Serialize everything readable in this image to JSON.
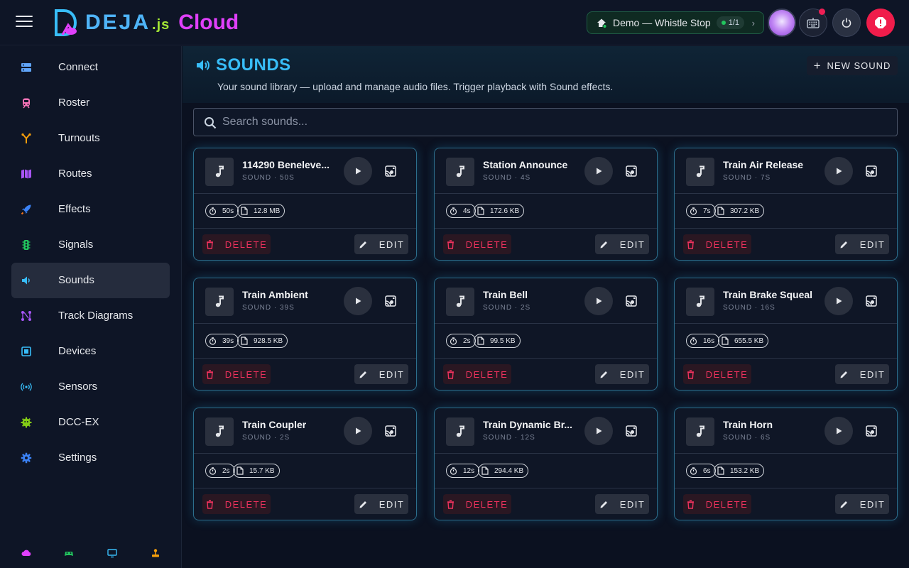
{
  "app": {
    "logo_deja": "DEJA",
    "logo_js": ".js",
    "logo_cloud": "Cloud"
  },
  "header": {
    "layout_label": "Demo — Whistle Stop",
    "layout_badge": "1/1",
    "colors": {
      "accent": "#38bdf8",
      "estop": "#f01d4b",
      "brand": "#e040fb"
    }
  },
  "sidebar": {
    "items": [
      {
        "label": "Connect",
        "icon": "server-icon",
        "color": "#60a5fa"
      },
      {
        "label": "Roster",
        "icon": "train-icon",
        "color": "#f472b6"
      },
      {
        "label": "Turnouts",
        "icon": "fork-icon",
        "color": "#f59e0b"
      },
      {
        "label": "Routes",
        "icon": "map-icon",
        "color": "#a855f7"
      },
      {
        "label": "Effects",
        "icon": "rocket-icon",
        "color": "#3b82f6"
      },
      {
        "label": "Signals",
        "icon": "traffic-light-icon",
        "color": "#22c55e"
      },
      {
        "label": "Sounds",
        "icon": "speaker-icon",
        "color": "#38bdf8"
      },
      {
        "label": "Track Diagrams",
        "icon": "graph-icon",
        "color": "#a855f7"
      },
      {
        "label": "Devices",
        "icon": "chip-icon",
        "color": "#38bdf8"
      },
      {
        "label": "Sensors",
        "icon": "broadcast-icon",
        "color": "#38bdf8"
      },
      {
        "label": "DCC-EX",
        "icon": "cog-chip-icon",
        "color": "#84cc16"
      },
      {
        "label": "Settings",
        "icon": "gear-icon",
        "color": "#3b82f6"
      }
    ],
    "active": "Sounds"
  },
  "page": {
    "title": "SOUNDS",
    "subtitle": "Your sound library — upload and manage audio files. Trigger playback with Sound effects.",
    "new_button": "NEW SOUND",
    "search_placeholder": "Search sounds..."
  },
  "sounds": [
    {
      "name": "114290 Beneleve...",
      "meta": "SOUND · 50S",
      "duration": "50s",
      "size": "12.8 MB"
    },
    {
      "name": "Station Announce",
      "meta": "SOUND · 4S",
      "duration": "4s",
      "size": "172.6 KB"
    },
    {
      "name": "Train Air Release",
      "meta": "SOUND · 7S",
      "duration": "7s",
      "size": "307.2 KB"
    },
    {
      "name": "Train Ambient",
      "meta": "SOUND · 39S",
      "duration": "39s",
      "size": "928.5 KB"
    },
    {
      "name": "Train Bell",
      "meta": "SOUND · 2S",
      "duration": "2s",
      "size": "99.5 KB"
    },
    {
      "name": "Train Brake Squeal",
      "meta": "SOUND · 16S",
      "duration": "16s",
      "size": "655.5 KB"
    },
    {
      "name": "Train Coupler",
      "meta": "SOUND · 2S",
      "duration": "2s",
      "size": "15.7 KB"
    },
    {
      "name": "Train Dynamic Br...",
      "meta": "SOUND · 12S",
      "duration": "12s",
      "size": "294.4 KB"
    },
    {
      "name": "Train Horn",
      "meta": "SOUND · 6S",
      "duration": "6s",
      "size": "153.2 KB"
    }
  ],
  "card_actions": {
    "delete": "DELETE",
    "edit": "EDIT"
  }
}
